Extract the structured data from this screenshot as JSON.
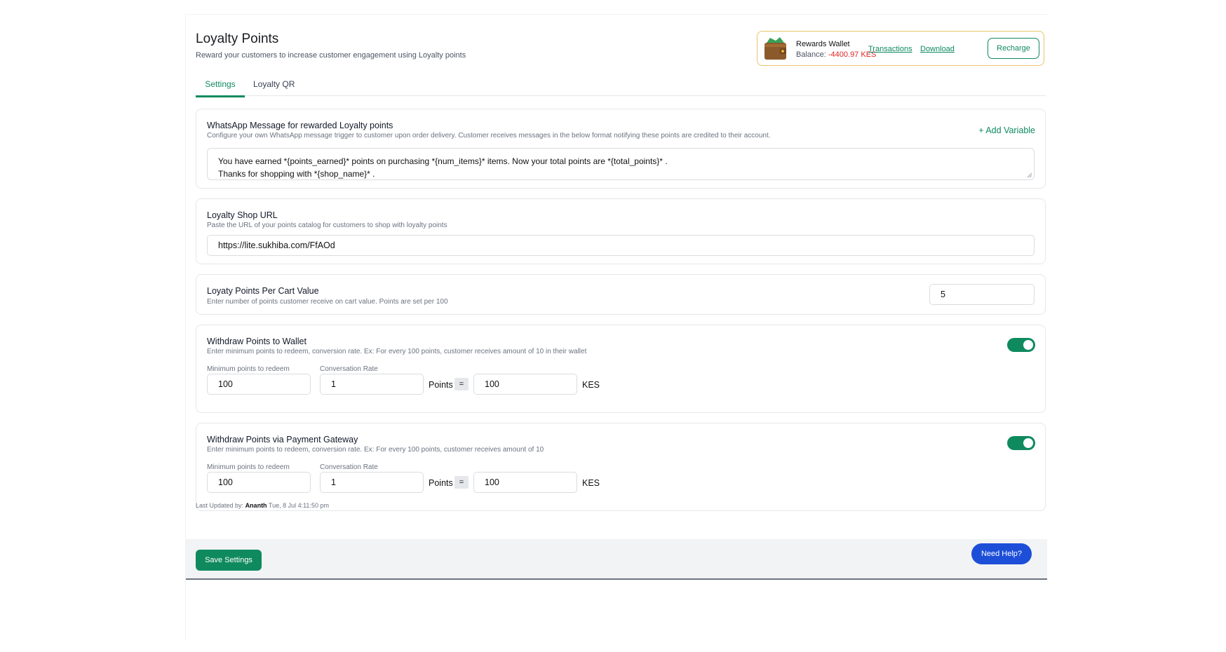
{
  "header": {
    "title": "Loyalty Points",
    "subtitle": "Reward your customers to increase customer engagement using Loyalty points"
  },
  "wallet": {
    "title": "Rewards Wallet",
    "balance_label": "Balance:",
    "balance_value": "-4400.97 KES",
    "transactions_label": "Transactions",
    "download_label": "Download",
    "recharge_label": "Recharge"
  },
  "tabs": [
    {
      "label": "Settings",
      "active": true
    },
    {
      "label": "Loyalty QR",
      "active": false
    }
  ],
  "whatsapp": {
    "title": "WhatsApp Message for rewarded Loyalty points",
    "description": "Configure your own WhatsApp message trigger to customer upon order delivery. Customer receives messages in the below format notifying these points are credited to their account.",
    "add_variable": "+ Add Variable",
    "message_line1": "You have earned *{points_earned}* points on purchasing *{num_items}* items. Now your total points are *{total_points}* .",
    "message_line2": "Thanks for shopping with *{shop_name}* ."
  },
  "shop_url": {
    "title": "Loyalty Shop URL",
    "description": "Paste the URL of your points catalog for customers to shop with loyalty points",
    "value": "https://lite.sukhiba.com/FfAOd"
  },
  "cart_value": {
    "title": "Loyaty Points Per Cart Value",
    "description": "Enter number of points customer receive on cart value. Points are set per 100",
    "value": "5"
  },
  "wallet_withdraw": {
    "title": "Withdraw Points to Wallet",
    "description": "Enter minimum points to redeem, conversion rate. Ex: For every 100 points, customer receives amount of 10 in their wallet",
    "enabled": true,
    "min_label": "Minimum points to redeem",
    "min_value": "100",
    "rate_label": "Conversation Rate",
    "rate_value": "1",
    "points_label": "Points",
    "equals": "=",
    "amount_value": "100",
    "currency": "KES"
  },
  "gateway_withdraw": {
    "title": "Withdraw Points via Payment Gateway",
    "description": "Enter minimum points to redeem, conversion rate. Ex: For every 100 points, customer receives amount of 10",
    "enabled": true,
    "min_label": "Minimum points to redeem",
    "min_value": "100",
    "rate_label": "Conversation Rate",
    "rate_value": "1",
    "points_label": "Points",
    "equals": "=",
    "amount_value": "100",
    "currency": "KES"
  },
  "updated": {
    "label": "Last Updated by:",
    "user": "Ananth",
    "time": "Tue, 8 Jul 4:11:50 pm"
  },
  "footer": {
    "save_label": "Save Settings",
    "help_label": "Need Help?"
  },
  "colors": {
    "accent": "#0f8a5f",
    "wallet_border": "#e9c46a",
    "negative": "#e02424",
    "help": "#1d4ed8"
  }
}
